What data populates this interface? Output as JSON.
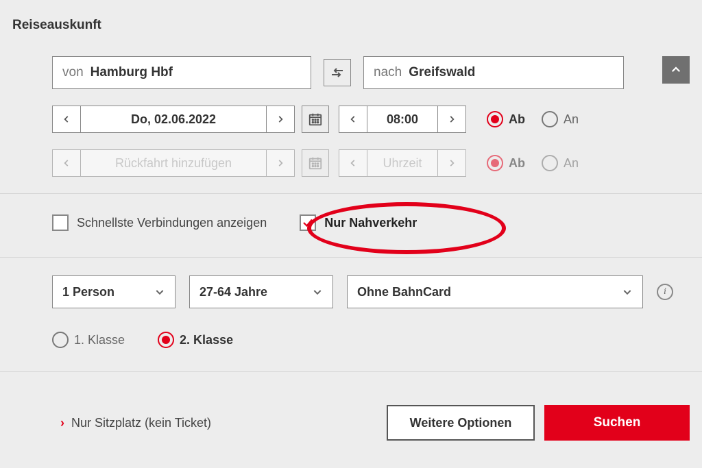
{
  "title": "Reiseauskunft",
  "from": {
    "label": "von",
    "value": "Hamburg Hbf"
  },
  "to": {
    "label": "nach",
    "value": "Greifswald"
  },
  "outbound": {
    "date": "Do, 02.06.2022",
    "time": "08:00"
  },
  "return": {
    "date_placeholder": "Rückfahrt hinzufügen",
    "time_placeholder": "Uhrzeit"
  },
  "radios": {
    "ab": "Ab",
    "an": "An"
  },
  "checks": {
    "fastest": "Schnellste Verbindungen anzeigen",
    "regional": "Nur Nahverkehr"
  },
  "selects": {
    "person": "1 Person",
    "age": "27-64 Jahre",
    "card": "Ohne BahnCard"
  },
  "classes": {
    "first": "1. Klasse",
    "second": "2. Klasse"
  },
  "seat_link": "Nur Sitzplatz (kein Ticket)",
  "buttons": {
    "options": "Weitere Optionen",
    "search": "Suchen"
  }
}
